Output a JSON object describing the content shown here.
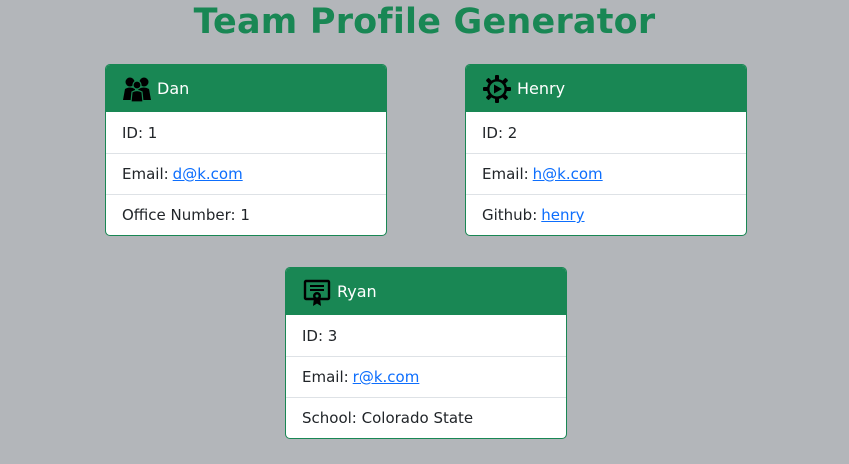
{
  "page": {
    "title": "Team Profile Generator"
  },
  "colors": {
    "accent": "#198754",
    "background": "#b3b6ba",
    "link": "#0d6efd"
  },
  "cards": [
    {
      "name": "Dan",
      "role_icon": "manager-people-icon",
      "id_label": "ID: 1",
      "email_label": "Email:",
      "email": "d@k.com",
      "extra_label": "Office Number: 1"
    },
    {
      "name": "Henry",
      "role_icon": "engineer-gear-icon",
      "id_label": "ID: 2",
      "email_label": "Email:",
      "email": "h@k.com",
      "extra_label": "Github:",
      "extra_link": "henry"
    },
    {
      "name": "Ryan",
      "role_icon": "intern-certificate-icon",
      "id_label": "ID: 3",
      "email_label": "Email:",
      "email": "r@k.com",
      "extra_label": "School: Colorado State"
    }
  ]
}
